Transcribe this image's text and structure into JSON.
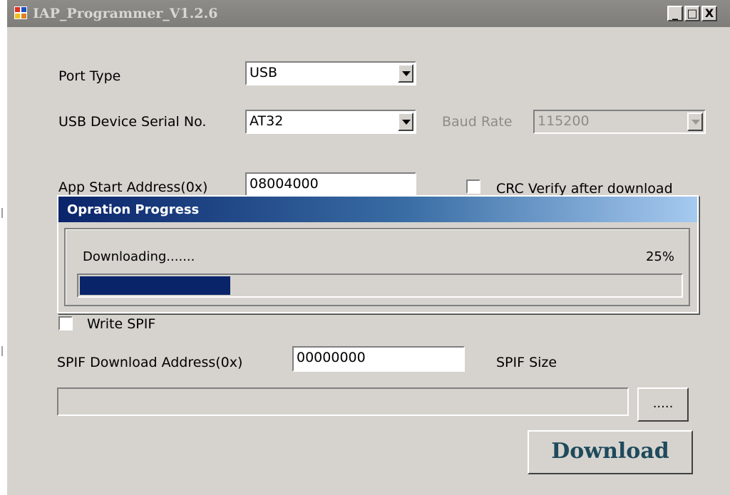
{
  "window": {
    "title": "IAP_Programmer_V1.2.6",
    "controls": {
      "minimize": "_",
      "maximize": "□",
      "close": "X"
    }
  },
  "form": {
    "port_type_label": "Port Type",
    "port_type_value": "USB",
    "usb_serial_label": "USB Device Serial No.",
    "usb_serial_value": "AT32",
    "baud_rate_label": "Baud Rate",
    "baud_rate_value": "115200",
    "app_start_label": "App Start Address(0x)",
    "app_start_value": "08004000",
    "crc_label": "CRC Verify after download",
    "crc_checked": false,
    "write_spif_label": "Write SPIF",
    "write_spif_checked": false,
    "spif_address_label": "SPIF Download Address(0x)",
    "spif_address_value": "00000000",
    "spif_size_label": "SPIF Size",
    "file_path_value": "",
    "browse_label": ".....",
    "download_label": "Download"
  },
  "progress_dialog": {
    "title": "Opration Progress",
    "status": "Downloading.......",
    "percent_text": "25%",
    "percent": 25
  },
  "colors": {
    "window_bg": "#d6d3ce",
    "progress_fill": "#0a246a",
    "download_text": "#1e4a5c"
  }
}
